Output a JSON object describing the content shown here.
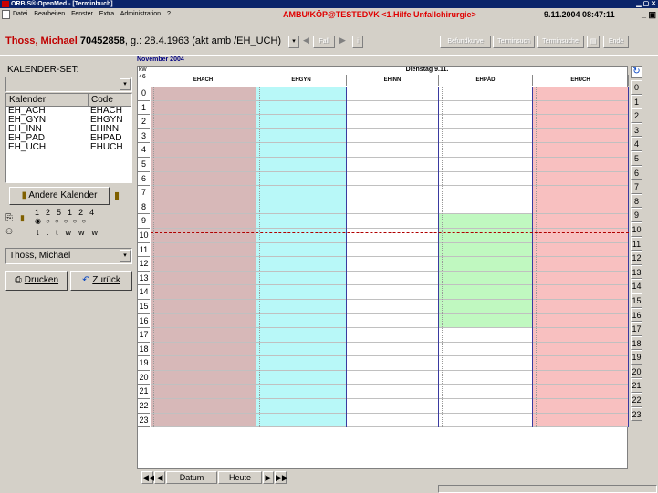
{
  "window": {
    "title": "ORBIS® OpenMed - [Terminbuch]"
  },
  "menu": {
    "items": [
      "Datei",
      "Bearbeiten",
      "Fenster",
      "Extra",
      "Administration",
      "?"
    ],
    "context": "AMBU/KÖP@TESTEDVK <1.Hilfe Unfallchirurgie>",
    "datetime": "9.11.2004 08:47:11"
  },
  "patient": {
    "name": "Thoss, Michael",
    "id": "70452858",
    "details": ", g.: 28.4.1963 (akt amb /EH_UCH)",
    "toolbar": {
      "fall": "Fall",
      "befundkurve": "Befundkurve",
      "termin_such": "Terminsuch",
      "termin_suche": "Terminsuche",
      "ende": "Ende"
    }
  },
  "sidebar": {
    "set_label": "KALENDER-SET:",
    "table_headers": {
      "kalender": "Kalender",
      "code": "Code"
    },
    "rows": [
      {
        "kalender": "EH_ACH",
        "code": "EHACH"
      },
      {
        "kalender": "EH_GYN",
        "code": "EHGYN"
      },
      {
        "kalender": "EH_INN",
        "code": "EHINN"
      },
      {
        "kalender": "EH_PÄD",
        "code": "EHPÄD"
      },
      {
        "kalender": "EH_UCH",
        "code": "EHUCH"
      }
    ],
    "andere_kalender": "Andere Kalender",
    "radio_numbers": [
      "1",
      "2",
      "5",
      "1",
      "2",
      "4"
    ],
    "radio_units": [
      "t",
      "t",
      "t",
      "w",
      "w",
      "w"
    ],
    "user": "Thoss, Michael",
    "drucken": "Drucken",
    "zurueck": "Zurück"
  },
  "calendar": {
    "month": "November 2004",
    "kw_label": "kw",
    "kw": "46",
    "day": "Dienstag 9.11.",
    "columns": [
      {
        "code": "EHACH",
        "color": "#d7b8b8"
      },
      {
        "code": "EHGYN",
        "color": "#b8f8f8"
      },
      {
        "code": "EHINN",
        "color": "#ffffff"
      },
      {
        "code": "EHPÄD",
        "color": "#ffffff"
      },
      {
        "code": "EHUCH",
        "color": "#f8c0c0"
      }
    ],
    "hours": [
      "0",
      "1",
      "2",
      "3",
      "4",
      "5",
      "6",
      "7",
      "8",
      "9",
      "10",
      "11",
      "12",
      "13",
      "14",
      "15",
      "16",
      "17",
      "18",
      "19",
      "20",
      "21",
      "22",
      "23"
    ],
    "paed_block": {
      "from": 9,
      "to": 17,
      "color": "#c0f8c0"
    },
    "current_time": "08:47"
  },
  "nav": {
    "datum": "Datum",
    "heute": "Heute"
  }
}
